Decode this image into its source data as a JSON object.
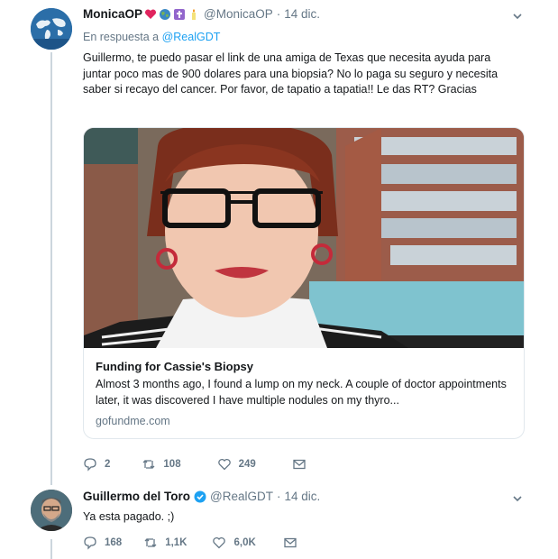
{
  "tweet1": {
    "name": "MonicaOP",
    "handle": "@MonicaOP",
    "separator": "·",
    "time": "14 dic.",
    "reply_prefix": "En respuesta a",
    "reply_mention": "@RealGDT",
    "text": "Guillermo, te puedo pasar el link de una amiga de Texas que necesita ayuda para juntar poco mas de 900 dolares para una biopsia? No lo paga su seguro y necesita saber si recayo del cancer. Por favor, de tapatio a tapatia!! Le das RT? Gracias",
    "card": {
      "title": "Funding for Cassie's Biopsy",
      "description": "Almost 3 months ago, I found a lump on my neck. A couple of doctor appointments later, it was discovered I have multiple nodules on my thyro...",
      "domain": "gofundme.com"
    },
    "actions": {
      "replies": "2",
      "retweets": "108",
      "likes": "249"
    }
  },
  "tweet2": {
    "name": "Guillermo del Toro",
    "handle": "@RealGDT",
    "separator": "·",
    "time": "14 dic.",
    "text": "Ya esta pagado.  ;)",
    "actions": {
      "replies": "168",
      "retweets": "1,1K",
      "likes": "6,0K"
    }
  },
  "icons": {
    "reply": "reply-icon",
    "retweet": "retweet-icon",
    "like": "heart-icon",
    "dm": "envelope-icon",
    "more": "chevron-down-icon",
    "verified": "verified-badge-icon"
  },
  "colors": {
    "link": "#1da1f2",
    "muted": "#657786",
    "text": "#14171a",
    "heart_emoji": "#e0245e",
    "verified": "#1da1f2"
  }
}
